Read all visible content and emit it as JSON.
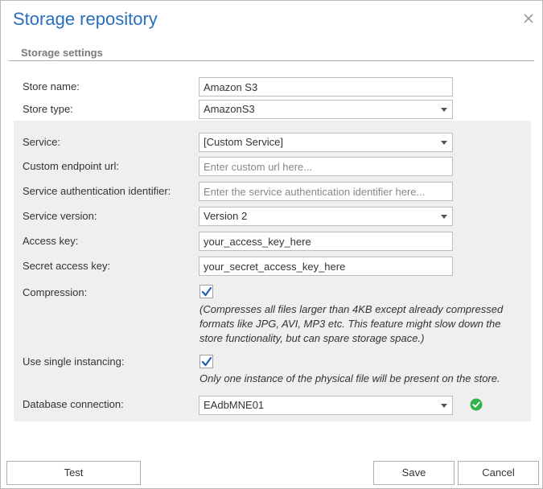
{
  "dialog": {
    "title": "Storage repository",
    "section_title": "Storage settings"
  },
  "fields": {
    "store_name": {
      "label": "Store name:",
      "value": "Amazon S3"
    },
    "store_type": {
      "label": "Store type:",
      "value": "AmazonS3"
    },
    "service": {
      "label": "Service:",
      "value": "[Custom Service]"
    },
    "custom_endpoint": {
      "label": "Custom endpoint url:",
      "value": "",
      "placeholder": "Enter custom url here..."
    },
    "service_auth_id": {
      "label": "Service authentication identifier:",
      "value": "",
      "placeholder": "Enter the service authentication identifier here..."
    },
    "service_version": {
      "label": "Service version:",
      "value": "Version 2"
    },
    "access_key": {
      "label": "Access key:",
      "value": "your_access_key_here"
    },
    "secret_access_key": {
      "label": "Secret access key:",
      "value": "your_secret_access_key_here"
    },
    "compression": {
      "label": "Compression:",
      "checked": true,
      "note_lines": [
        "(Compresses all files larger than 4KB except already compressed",
        "formats like JPG, AVI, MP3 etc. This feature might slow down the",
        "store functionality, but can spare storage space.)"
      ]
    },
    "single_instancing": {
      "label": "Use single instancing:",
      "checked": true,
      "note": "Only one instance of the physical file will be present on the store."
    },
    "database_connection": {
      "label": "Database connection:",
      "value": "EAdbMNE01"
    }
  },
  "buttons": {
    "test": "Test",
    "save": "Save",
    "cancel": "Cancel"
  },
  "icons": {
    "close": "close-icon",
    "status": "check-circle-icon",
    "checkbox": "checkmark-icon",
    "dropdown": "chevron-down-icon"
  },
  "colors": {
    "title": "#2a6ebf",
    "checkmark": "#1f5fb5",
    "status_ok": "#2fb34a",
    "panel_bg": "#efefef"
  }
}
